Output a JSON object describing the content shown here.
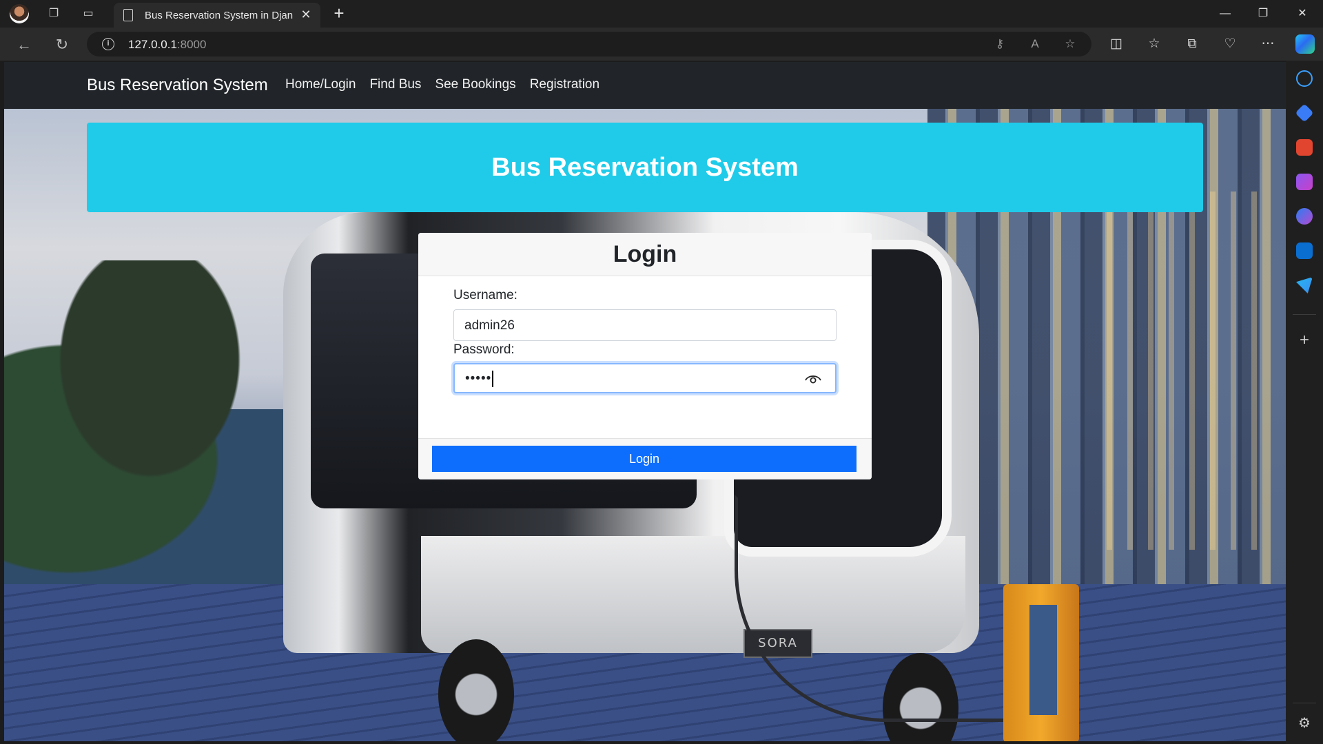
{
  "browser": {
    "tab_title": "Bus Reservation System in Djang",
    "url_host": "127.0.0.1",
    "url_port": ":8000"
  },
  "navbar": {
    "brand": "Bus Reservation System",
    "links": [
      "Home/Login",
      "Find Bus",
      "See Bookings",
      "Registration"
    ]
  },
  "hero": {
    "title": "Bus Reservation System",
    "background_image": "electric bus at charging station",
    "bus_plate": "SORA"
  },
  "login": {
    "title": "Login",
    "username_label": "Username:",
    "username_value": "admin26",
    "password_label": "Password:",
    "password_mask": "•••••",
    "submit_label": "Login"
  },
  "colors": {
    "navbar": "#212529",
    "hero": "#1fcbe9",
    "primary": "#0d6efd"
  },
  "icons": {
    "password_toggle": "eye-icon",
    "site_info": "info-icon"
  }
}
